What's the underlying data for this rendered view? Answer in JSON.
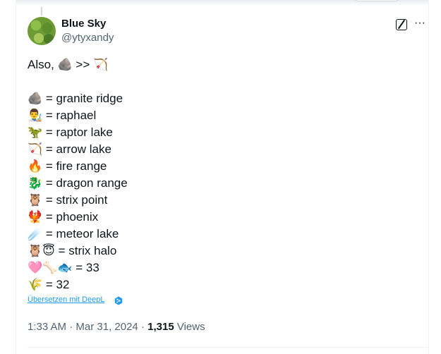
{
  "author": {
    "display_name": "Blue Sky",
    "handle": "@ytyxandy"
  },
  "icons": {
    "grok": "grok-icon",
    "more": "more-icon",
    "deepl": "deepl-icon"
  },
  "tweet": {
    "intro": "Also, 🪨 >> 🏹",
    "lines": [
      "🪨 = granite ridge",
      "👨‍🎨 = raphael",
      "🦖 = raptor lake",
      "🏹 = arrow lake",
      "🔥 = fire range",
      "🐉 = dragon range",
      "🦉 = strix point",
      "🐦‍🔥 = phoenix",
      "☄️ = meteor lake",
      "🦉😇 = strix halo",
      "🩷🦴🐟 = 33",
      "🌾 = 32"
    ]
  },
  "translate": {
    "label": "Übersetzen mit DeepL"
  },
  "meta": {
    "time": "1:33 AM",
    "date": "Mar 31, 2024",
    "separator": "·",
    "views_count": "1,315",
    "views_label": "Views"
  },
  "colors": {
    "text": "#0f1419",
    "secondary": "#536471",
    "link": "#1d9bf0",
    "divider": "#eff3f4"
  }
}
